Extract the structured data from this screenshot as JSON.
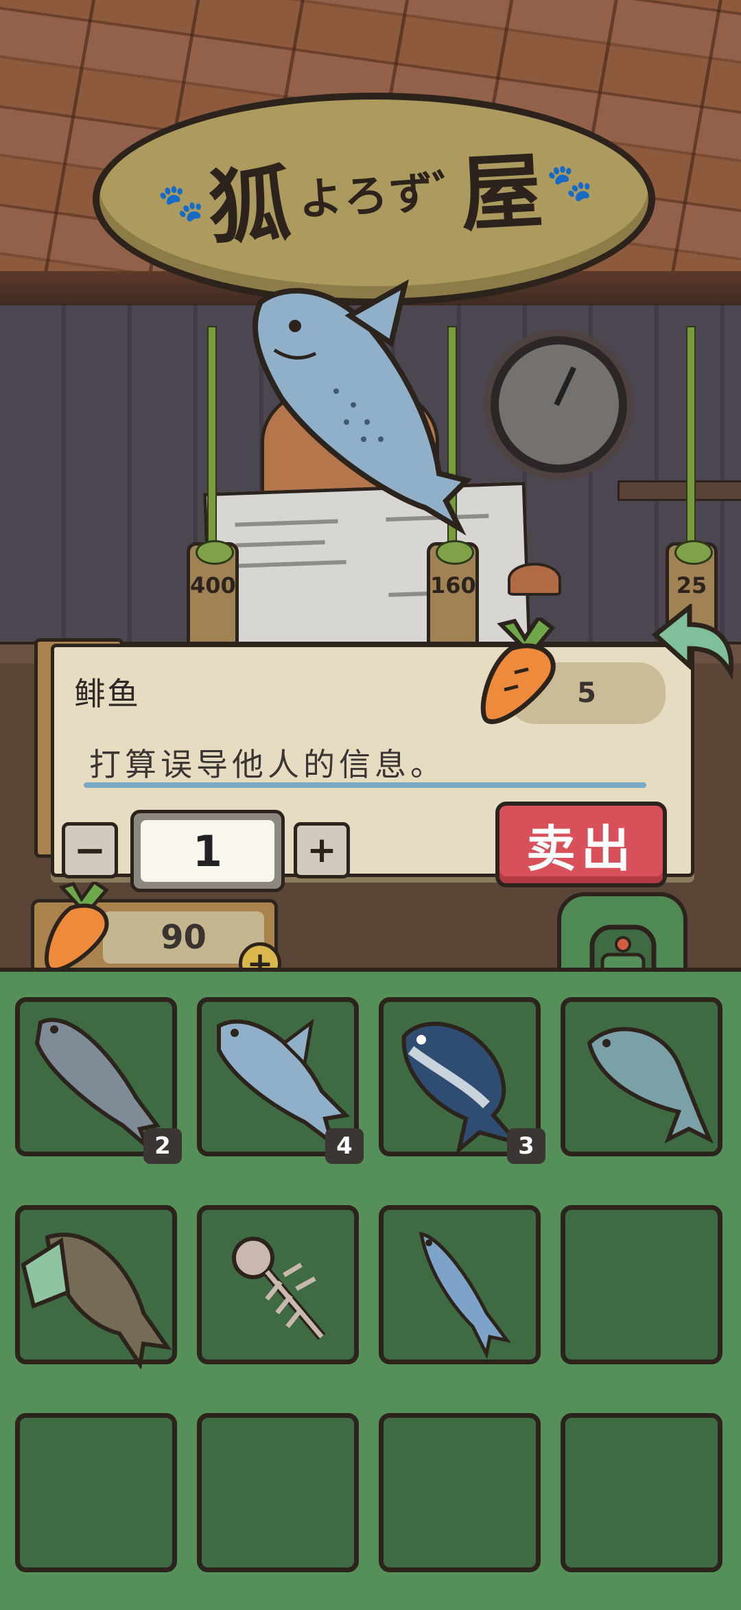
{
  "shop_sign": {
    "title_main": "狐",
    "title_small": "よろずﾞ",
    "title_end": "屋"
  },
  "price_tags": [
    "400",
    "160",
    "25"
  ],
  "item": {
    "name": "鲱鱼",
    "price": "5",
    "description": "打算误导他人的信息。"
  },
  "quantity": {
    "value": "1",
    "minus_label": "−",
    "plus_label": "+"
  },
  "sell_button_label": "卖出",
  "currency": {
    "amount": "90",
    "add_label": "+"
  },
  "inventory": {
    "slots": [
      {
        "item": "herring-fish-icon",
        "count": "2"
      },
      {
        "item": "salmon-fish-icon",
        "count": "4"
      },
      {
        "item": "tuna-fish-icon",
        "count": "3"
      },
      {
        "item": "sardine-fish-icon",
        "count": ""
      },
      {
        "item": "catfish-fish-icon",
        "count": ""
      },
      {
        "item": "fish-bone-icon",
        "count": ""
      },
      {
        "item": "small-fish-icon",
        "count": ""
      },
      {
        "item": "",
        "count": ""
      },
      {
        "item": "",
        "count": ""
      },
      {
        "item": "",
        "count": ""
      },
      {
        "item": "",
        "count": ""
      },
      {
        "item": "",
        "count": ""
      }
    ]
  },
  "colors": {
    "sell": "#d7505a",
    "inventory_bg": "#55905b",
    "slot_bg": "#3f6b43",
    "dialog_bg": "#e6dcc1"
  }
}
